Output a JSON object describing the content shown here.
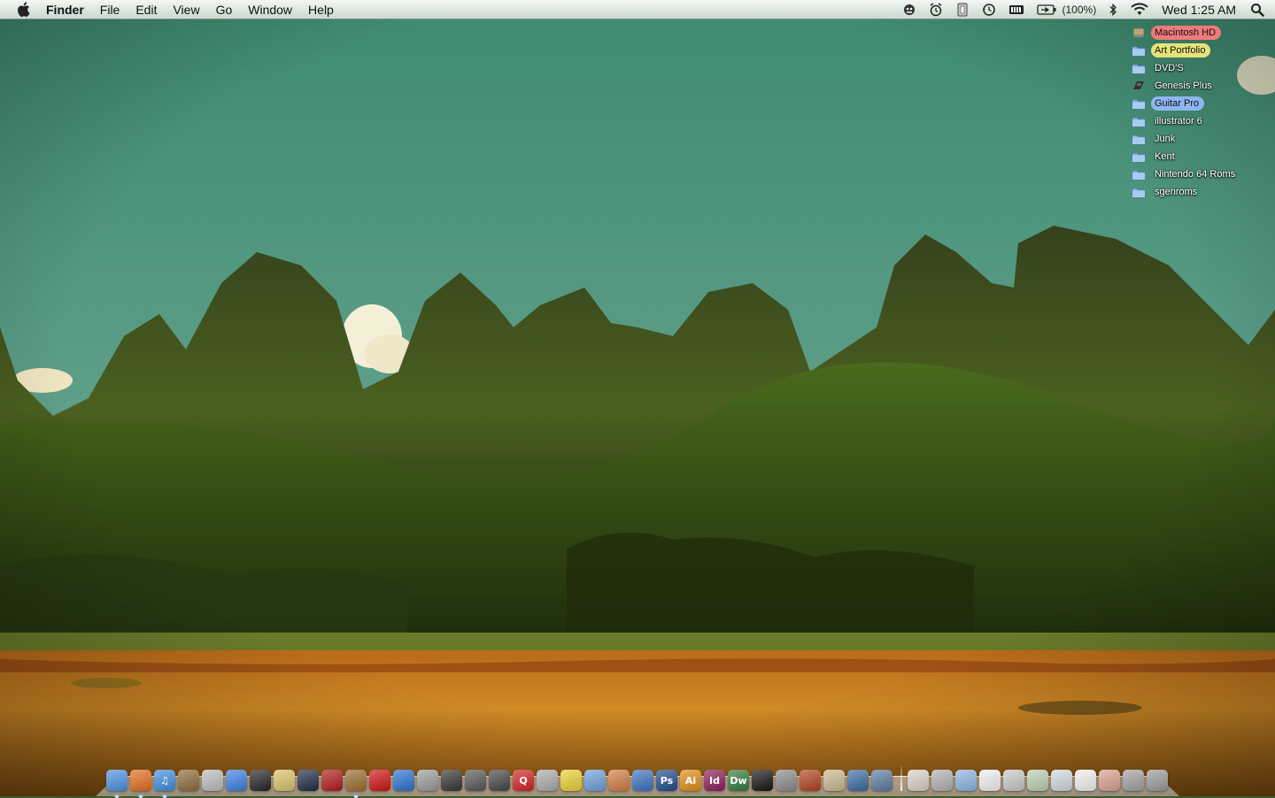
{
  "menubar": {
    "apple_icon": "apple-logo-icon",
    "app_name": "Finder",
    "menus": [
      "File",
      "Edit",
      "View",
      "Go",
      "Window",
      "Help"
    ],
    "status_icons": [
      "remote-icon",
      "alarm-clock-icon",
      "script-icon",
      "time-machine-icon",
      "battery-meter-icon",
      "battery-icon"
    ],
    "battery_percent": "(100%)",
    "bluetooth_icon": "bluetooth-icon",
    "wifi_icon": "wifi-icon",
    "clock": "Wed 1:25 AM",
    "spotlight_icon": "spotlight-search-icon"
  },
  "desktop": {
    "items": [
      {
        "label": "Macintosh HD",
        "icon": "hard-drive-icon",
        "label_color": "red"
      },
      {
        "label": "Art Portfolio",
        "icon": "folder-icon",
        "label_color": "yellow"
      },
      {
        "label": "DVD'S",
        "icon": "folder-icon",
        "label_color": ""
      },
      {
        "label": "Genesis Plus",
        "icon": "game-app-icon",
        "label_color": ""
      },
      {
        "label": "Guitar Pro",
        "icon": "folder-icon",
        "label_color": "blue"
      },
      {
        "label": "illustrator 6",
        "icon": "folder-icon",
        "label_color": ""
      },
      {
        "label": "Junk",
        "icon": "folder-icon",
        "label_color": ""
      },
      {
        "label": "Kent",
        "icon": "folder-icon",
        "label_color": ""
      },
      {
        "label": "Nintendo 64 Roms",
        "icon": "folder-icon",
        "label_color": ""
      },
      {
        "label": "sgenroms",
        "icon": "folder-icon",
        "label_color": ""
      }
    ]
  },
  "dock": {
    "apps": [
      {
        "name": "finder-icon",
        "glyph": "",
        "color": "#4a8fe0",
        "running": true
      },
      {
        "name": "firefox-icon",
        "glyph": "",
        "color": "#e36a1c",
        "running": true
      },
      {
        "name": "itunes-icon",
        "glyph": "♫",
        "color": "#3f8be0",
        "running": true
      },
      {
        "name": "iphoto-icon",
        "glyph": "",
        "color": "#8a6a3a",
        "running": false
      },
      {
        "name": "dvd-player-icon",
        "glyph": "",
        "color": "#bbbbbb",
        "running": false
      },
      {
        "name": "ichat-icon",
        "glyph": "",
        "color": "#3a7de0",
        "running": false
      },
      {
        "name": "imovie-icon",
        "glyph": "",
        "color": "#222222",
        "running": false
      },
      {
        "name": "popcorn-icon",
        "glyph": "",
        "color": "#d8c26a",
        "running": false
      },
      {
        "name": "quicktime-icon",
        "glyph": "",
        "color": "#1e2a44",
        "running": false
      },
      {
        "name": "front-row-icon",
        "glyph": "",
        "color": "#b01818",
        "running": false
      },
      {
        "name": "guitar-icon",
        "glyph": "",
        "color": "#9a6a30",
        "running": true
      },
      {
        "name": "record-icon",
        "glyph": "",
        "color": "#cc1010",
        "running": false
      },
      {
        "name": "itunes-disc-icon",
        "glyph": "",
        "color": "#2a6fd0",
        "running": false
      },
      {
        "name": "screenshot-icon",
        "glyph": "",
        "color": "#9a9a9a",
        "running": false
      },
      {
        "name": "game-console-icon",
        "glyph": "",
        "color": "#333333",
        "running": false
      },
      {
        "name": "n64-icon",
        "glyph": "",
        "color": "#555555",
        "running": false
      },
      {
        "name": "controller-icon",
        "glyph": "",
        "color": "#444444",
        "running": false
      },
      {
        "name": "quicktime-red-icon",
        "glyph": "Q",
        "color": "#d02020",
        "running": false
      },
      {
        "name": "drive-icon",
        "glyph": "",
        "color": "#aaaaaa",
        "running": false
      },
      {
        "name": "adium-icon",
        "glyph": "",
        "color": "#e8d030",
        "running": false
      },
      {
        "name": "wordpress-icon",
        "glyph": "",
        "color": "#6aa0d8",
        "running": false
      },
      {
        "name": "squid-icon",
        "glyph": "",
        "color": "#d07a40",
        "running": false
      },
      {
        "name": "preview-icon",
        "glyph": "",
        "color": "#3a70c0",
        "running": false
      },
      {
        "name": "photoshop-icon",
        "glyph": "Ps",
        "color": "#1c4a8a",
        "running": false
      },
      {
        "name": "illustrator-icon",
        "glyph": "Ai",
        "color": "#e08a10",
        "running": false
      },
      {
        "name": "indesign-icon",
        "glyph": "Id",
        "color": "#8a1a5a",
        "running": false
      },
      {
        "name": "dreamweaver-icon",
        "glyph": "Dw",
        "color": "#2e7a3a",
        "running": false
      },
      {
        "name": "terminal-icon",
        "glyph": "",
        "color": "#111111",
        "running": false
      },
      {
        "name": "system-preferences-icon",
        "glyph": "",
        "color": "#8a8a8a",
        "running": false
      },
      {
        "name": "utility-icon",
        "glyph": "",
        "color": "#b04020",
        "running": false
      },
      {
        "name": "script-editor-icon",
        "glyph": "",
        "color": "#c8b890",
        "running": false
      },
      {
        "name": "network-utility-icon",
        "glyph": "",
        "color": "#3a6aa0",
        "running": false
      },
      {
        "name": "image-capture-icon",
        "glyph": "",
        "color": "#5a7aa0",
        "running": false
      }
    ],
    "docs": [
      {
        "name": "applications-stack-icon",
        "color": "#d8d0c8"
      },
      {
        "name": "downloads-stack-icon",
        "color": "#b0b0b0"
      },
      {
        "name": "folder-stack-icon",
        "color": "#8ab4e0"
      },
      {
        "name": "document-stack-icon",
        "color": "#f0f0f0"
      },
      {
        "name": "screenshot-stack-icon",
        "color": "#c8c8c8"
      },
      {
        "name": "photos-stack-icon",
        "color": "#b8d0b0"
      },
      {
        "name": "window-stack-icon",
        "color": "#d0d8e0"
      },
      {
        "name": "text-doc-stack-icon",
        "color": "#f0f0f0"
      },
      {
        "name": "pictures-stack-icon",
        "color": "#d8a090"
      },
      {
        "name": "pencil-stack-icon",
        "color": "#a0a0a0"
      },
      {
        "name": "trash-icon",
        "color": "#9a9a9a"
      }
    ]
  }
}
